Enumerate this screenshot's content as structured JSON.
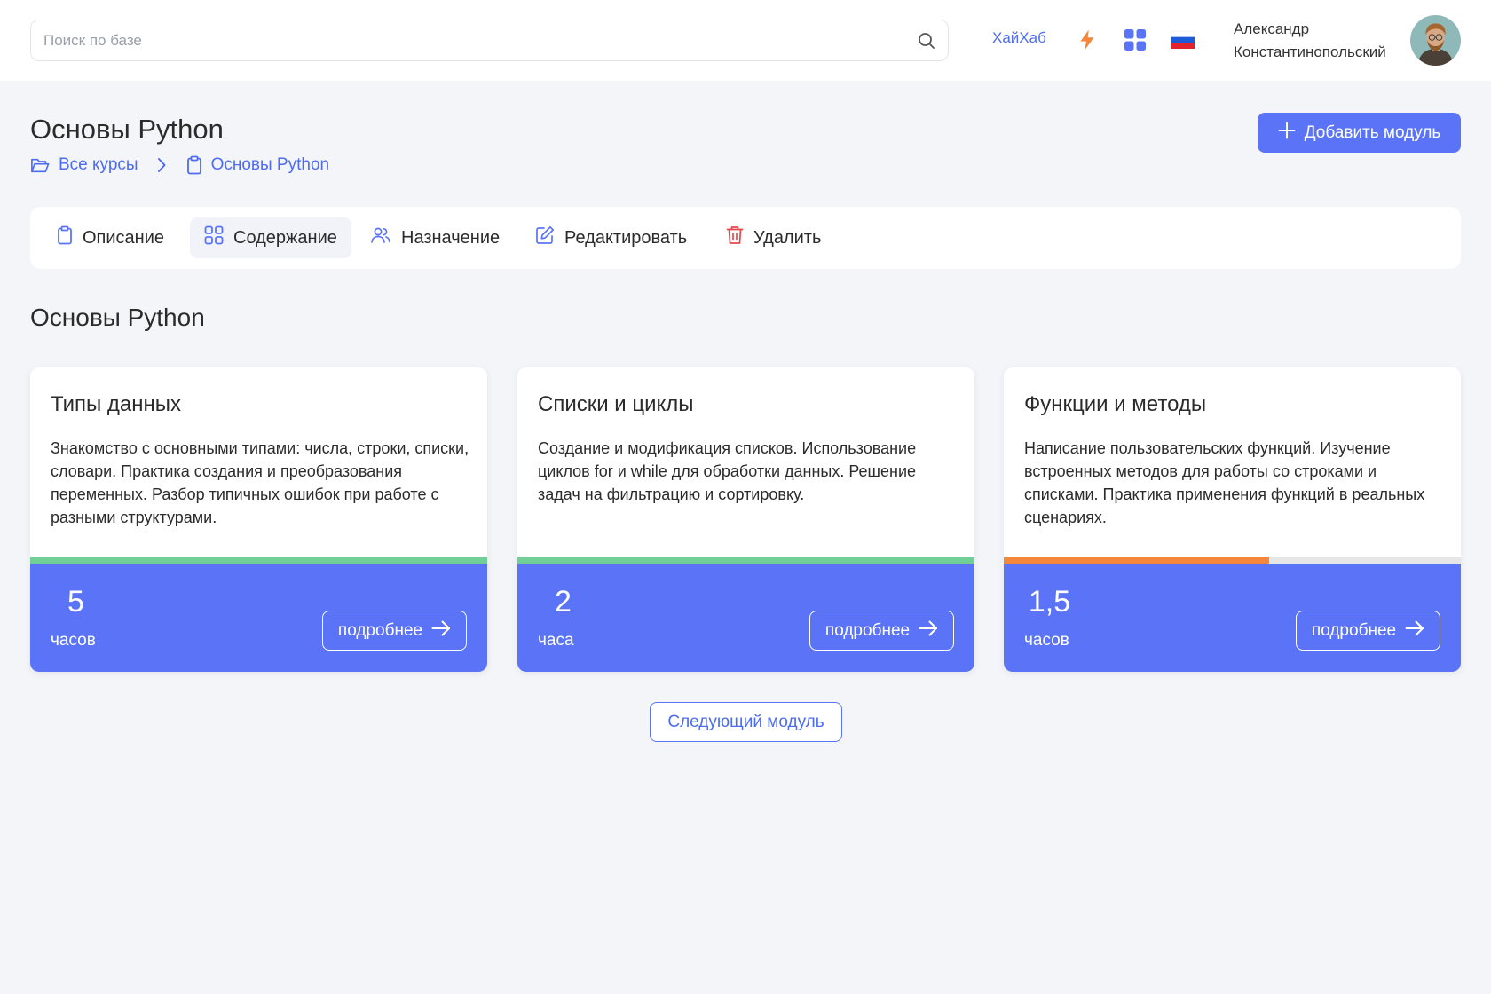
{
  "header": {
    "search_placeholder": "Поиск по базе",
    "search_value": "",
    "hub_link": "ХайХаб",
    "user": {
      "first_name": "Александр",
      "last_name": "Константинопольский"
    },
    "icons": [
      "search-icon",
      "lightning-icon",
      "apps-grid-icon",
      "russian-flag-icon"
    ]
  },
  "page": {
    "title": "Основы Python",
    "breadcrumb": [
      {
        "label": "Все курсы",
        "icon": "folder-icon"
      },
      {
        "label": "Основы Python",
        "icon": "clipboard-icon"
      }
    ],
    "add_button": "Добавить модуль"
  },
  "tabs": [
    {
      "label": "Описание",
      "icon": "clipboard-icon",
      "active": false
    },
    {
      "label": "Содержание",
      "icon": "grid-icon",
      "active": true
    },
    {
      "label": "Назначение",
      "icon": "users-icon",
      "active": false
    },
    {
      "label": "Редактировать",
      "icon": "edit-icon",
      "active": false
    },
    {
      "label": "Удалить",
      "icon": "trash-icon",
      "active": false
    }
  ],
  "section_title": "Основы Python",
  "modules": [
    {
      "title": "Типы данных",
      "description": "Знакомство с основными типами: числа, строки, списки, словари. Практика создания и преобразования переменных. Разбор типичных ошибок при работе с разными структурами.",
      "hours": "5",
      "hours_unit": "часов",
      "progress": 1.0,
      "progress_color": "#6fcf97",
      "more_label": "подробнее"
    },
    {
      "title": "Списки и циклы",
      "description": "Создание и модификация списков. Использование циклов for и while для обработки данных. Решение задач на фильтрацию и сортировку.",
      "hours": "2",
      "hours_unit": "часа",
      "progress": 1.0,
      "progress_color": "#6fcf97",
      "more_label": "подробнее"
    },
    {
      "title": "Функции и методы",
      "description": "Написание пользовательских функций. Изучение встроенных методов для работы со строками и списками. Практика применения функций в реальных сценариях.",
      "hours": "1,5",
      "hours_unit": "часов",
      "progress": 0.58,
      "progress_color": "#f5873a",
      "more_label": "подробнее"
    }
  ],
  "next_button": "Следующий модуль",
  "colors": {
    "accent": "#5b74f7",
    "link": "#4d6cf0",
    "background": "#f4f5f9",
    "danger": "#e5484d",
    "lightning": "#f5873a"
  }
}
